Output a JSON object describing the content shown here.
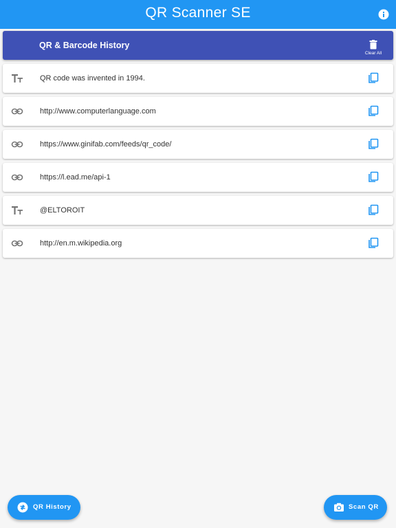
{
  "appbar": {
    "title": "QR Scanner SE",
    "info_icon": "info-icon"
  },
  "history_header": {
    "title": "QR & Barcode History",
    "clear_all_label": "Clear All",
    "clear_icon": "trash-icon"
  },
  "items": [
    {
      "type": "text",
      "icon": "text-format-icon",
      "text": "QR code was invented in 1994."
    },
    {
      "type": "url",
      "icon": "link-icon",
      "text": "http://www.computerlanguage.com"
    },
    {
      "type": "url",
      "icon": "link-icon",
      "text": "https://www.ginifab.com/feeds/qr_code/"
    },
    {
      "type": "url",
      "icon": "link-icon",
      "text": "https://l.ead.me/api-1"
    },
    {
      "type": "text",
      "icon": "text-format-icon",
      "text": "@ELTOROIT"
    },
    {
      "type": "url",
      "icon": "link-icon",
      "text": "http://en.m.wikipedia.org"
    }
  ],
  "fab_left": {
    "label": "QR History",
    "icon": "swap-icon"
  },
  "fab_right": {
    "label": "Scan QR",
    "icon": "camera-icon"
  },
  "colors": {
    "appbar": "#2196f3",
    "header": "#3f51b5",
    "accent": "#2196f3",
    "icon_gray": "#757575"
  }
}
